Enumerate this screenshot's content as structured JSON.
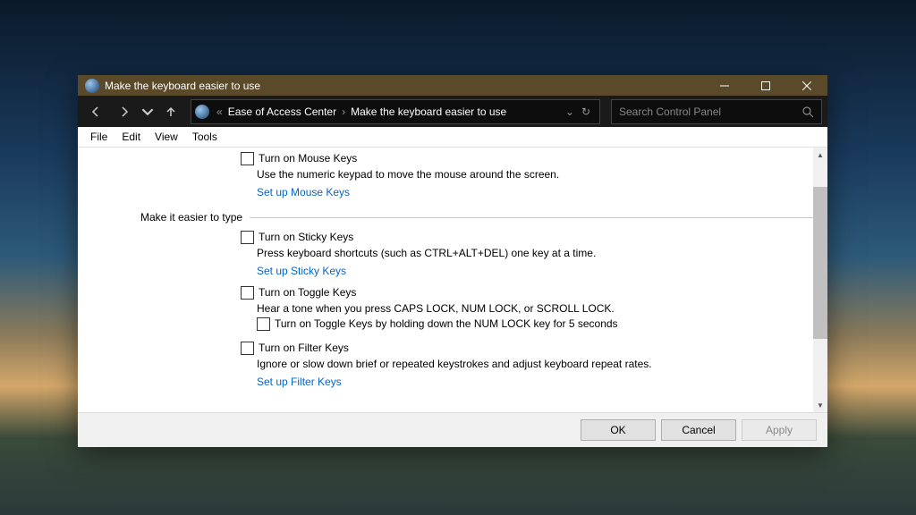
{
  "titlebar": {
    "title": "Make the keyboard easier to use"
  },
  "breadcrumb": {
    "seg1": "Ease of Access Center",
    "seg2": "Make the keyboard easier to use"
  },
  "search": {
    "placeholder": "Search Control Panel"
  },
  "menus": {
    "file": "File",
    "edit": "Edit",
    "view": "View",
    "tools": "Tools"
  },
  "mouse": {
    "cb_label": "Turn on Mouse Keys",
    "desc": "Use the numeric keypad to move the mouse around the screen.",
    "link": "Set up Mouse Keys"
  },
  "section_type": "Make it easier to type",
  "sticky": {
    "cb_label": "Turn on Sticky Keys",
    "desc": "Press keyboard shortcuts (such as CTRL+ALT+DEL) one key at a time.",
    "link": "Set up Sticky Keys"
  },
  "toggle": {
    "cb_label": "Turn on Toggle Keys",
    "desc": "Hear a tone when you press CAPS LOCK, NUM LOCK, or SCROLL LOCK.",
    "sub_cb": "Turn on Toggle Keys by holding down the NUM LOCK key for 5 seconds"
  },
  "filter": {
    "cb_label": "Turn on Filter Keys",
    "desc": "Ignore or slow down brief or repeated keystrokes and adjust keyboard repeat rates.",
    "link": "Set up Filter Keys"
  },
  "buttons": {
    "ok": "OK",
    "cancel": "Cancel",
    "apply": "Apply"
  }
}
